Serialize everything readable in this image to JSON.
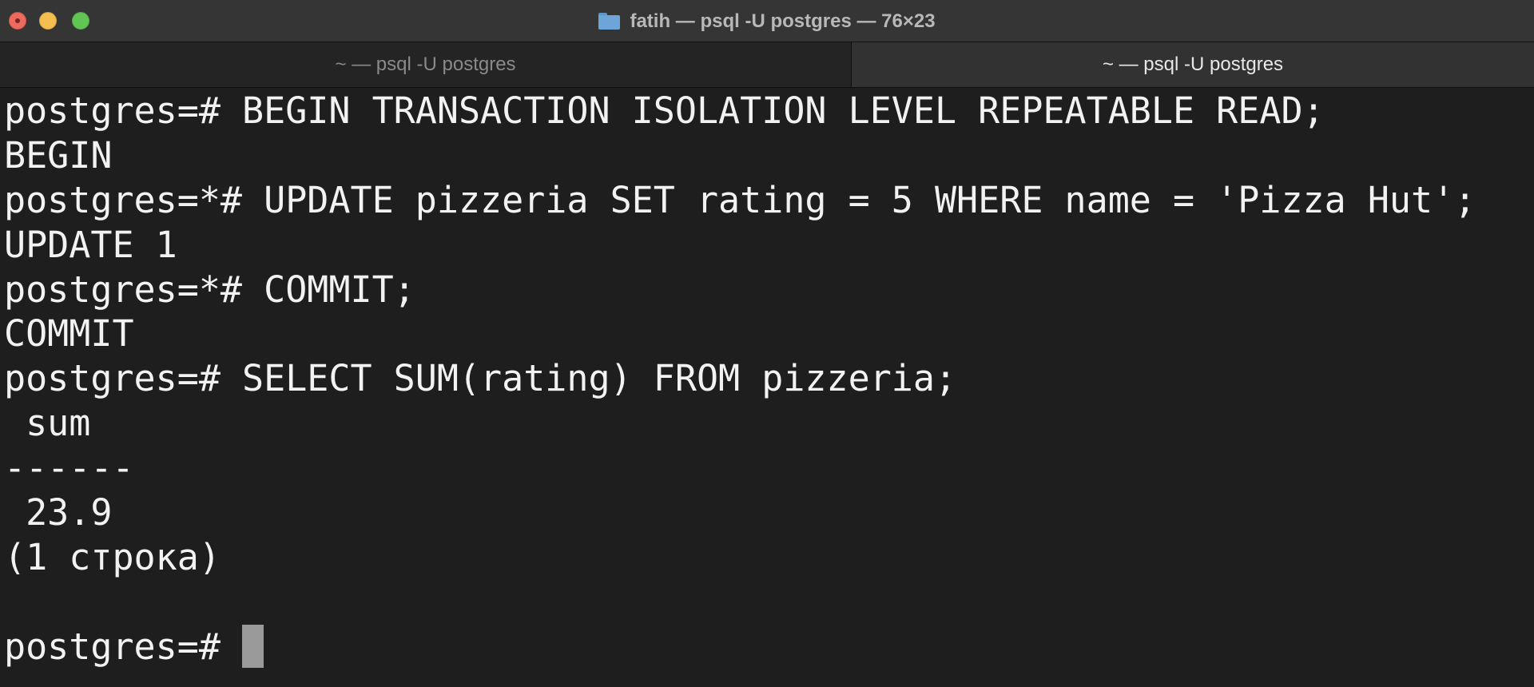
{
  "window": {
    "title": "fatih — psql -U postgres — 76×23"
  },
  "tabs": [
    {
      "label": "~ — psql -U postgres",
      "active": false
    },
    {
      "label": "~ — psql -U postgres",
      "active": true
    }
  ],
  "terminal": {
    "lines": [
      "postgres=# BEGIN TRANSACTION ISOLATION LEVEL REPEATABLE READ;",
      "BEGIN",
      "postgres=*# UPDATE pizzeria SET rating = 5 WHERE name = 'Pizza Hut';",
      "UPDATE 1",
      "postgres=*# COMMIT;",
      "COMMIT",
      "postgres=# SELECT SUM(rating) FROM pizzeria;",
      " sum",
      "------",
      " 23.9",
      "(1 строка)",
      ""
    ],
    "prompt": "postgres=# "
  },
  "colors": {
    "background": "#1e1e1e",
    "foreground": "#f2f2f2",
    "titlebar": "#353535",
    "cursor": "#9a9a9a"
  }
}
